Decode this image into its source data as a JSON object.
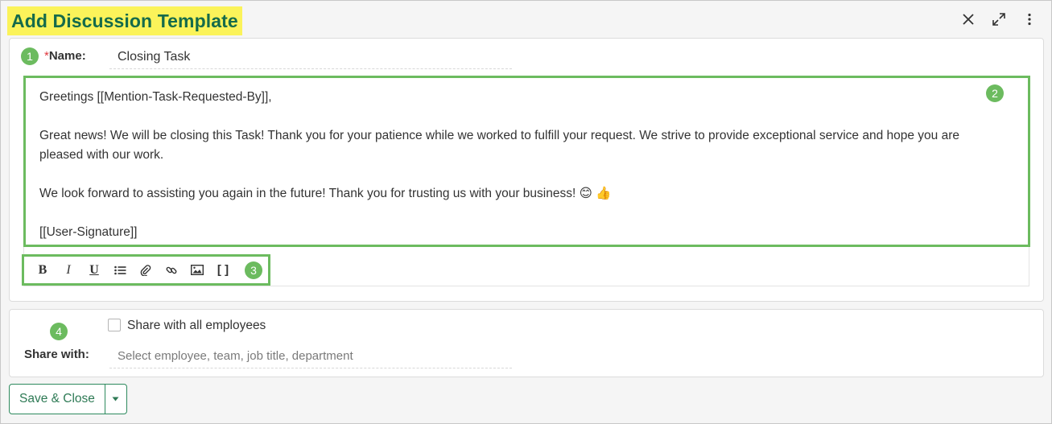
{
  "dialog": {
    "title": "Add Discussion Template",
    "header_icons": [
      "close-icon",
      "expand-icon",
      "more-vertical-icon"
    ]
  },
  "badges": [
    "1",
    "2",
    "3",
    "4"
  ],
  "name_field": {
    "required_mark": "*",
    "label": "Name:",
    "value": "Closing Task"
  },
  "editor": {
    "line1": "Greetings [[Mention-Task-Requested-By]],",
    "paragraph2": "Great news! We will be closing this Task! Thank you for your patience while we worked to fulfill your request. We strive to provide exceptional service and hope you are pleased with our work.",
    "paragraph3": "We look forward to assisting you again in the future! Thank you for trusting us with your business! 😊 👍",
    "signature": "[[User-Signature]]"
  },
  "toolbar": {
    "bold": "B",
    "italic": "I",
    "underline": "U",
    "brackets": "[ ]",
    "icons": [
      "bold-icon",
      "italic-icon",
      "underline-icon",
      "bullet-list-icon",
      "attachment-icon",
      "link-icon",
      "image-icon",
      "placeholder-brackets-icon"
    ]
  },
  "share": {
    "checkbox_label": "Share with all employees",
    "label": "Share with:",
    "placeholder": "Select employee, team, job title, department"
  },
  "actions": {
    "save_close": "Save & Close"
  },
  "colors": {
    "highlight": "#fbf35a",
    "title_text": "#156b4b",
    "annotation_green": "#6cbb5f",
    "button_green": "#2e8a5e"
  }
}
